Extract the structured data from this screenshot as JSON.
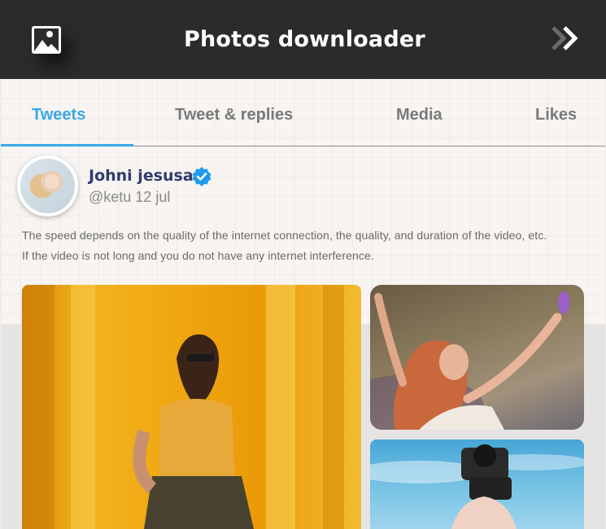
{
  "header": {
    "title": "Photos downloader",
    "app_icon": "image-icon",
    "forward_icon": "double-chevron-right-icon"
  },
  "tabs": [
    {
      "label": "Tweets",
      "active": true
    },
    {
      "label": "Tweet & replies",
      "active": false
    },
    {
      "label": "Media",
      "active": false
    },
    {
      "label": "Likes",
      "active": false
    }
  ],
  "profile": {
    "name": "Johni jesusa",
    "handle_date": "@ketu 12 jul",
    "verified_icon": "verified-badge-icon"
  },
  "tweet": {
    "line1": "The speed depends on the quality of the internet connection, the quality, and duration of the video, etc.",
    "line2": "If the video is not long and you do not have any internet interference."
  },
  "colors": {
    "header_bg": "#2b2b2b",
    "accent": "#3aa7e8",
    "name": "#2f3b6b",
    "verified": "#1d9bf0"
  }
}
